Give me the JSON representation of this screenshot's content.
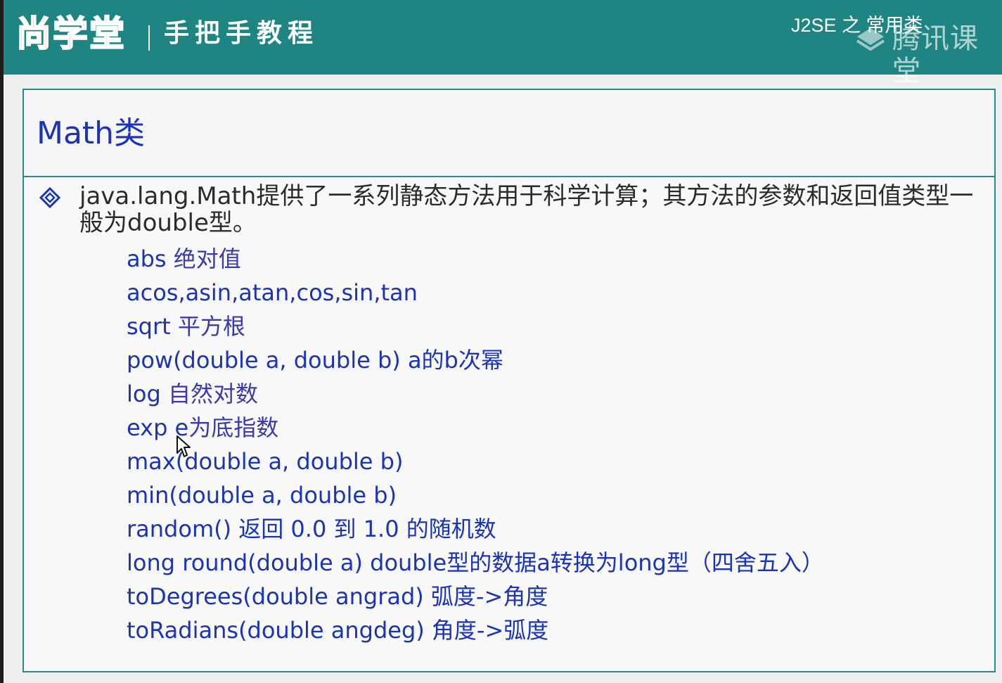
{
  "header": {
    "logo_text": "尚学堂",
    "tagline": "手把手教程",
    "course_title": "J2SE 之 常用类",
    "watermark_text": "腾讯课堂",
    "background_color": "#1f8582"
  },
  "slide": {
    "title": "Math类",
    "intro": "java.lang.Math提供了一系列静态方法用于科学计算；其方法的参数和返回值类型一般为double型。",
    "methods": [
      {
        "sig": "abs",
        "desc": " 绝对值"
      },
      {
        "sig": "acos,asin,atan,cos,sin,tan",
        "desc": ""
      },
      {
        "sig": "sqrt",
        "desc": " 平方根"
      },
      {
        "sig": "pow(double a, double b) a的b次幂",
        "desc": ""
      },
      {
        "sig": "log",
        "desc": " 自然对数"
      },
      {
        "sig": "exp e",
        "desc": "为底指数"
      },
      {
        "sig": "max(double a, double b)",
        "desc": ""
      },
      {
        "sig": "min(double a, double b)",
        "desc": ""
      },
      {
        "sig": "random() 返回 0.0 到 1.0 的随机数",
        "desc": ""
      },
      {
        "sig": "long round(double a) double型的数据a转换为long型（四舍五入）",
        "desc": ""
      },
      {
        "sig": "toDegrees(double angrad) 弧度->角度",
        "desc": ""
      },
      {
        "sig": "toRadians(double angdeg) 角度->弧度",
        "desc": ""
      }
    ],
    "accent_color": "#1a34b4",
    "border_color": "#2a8a86"
  },
  "icons": {
    "bullet": "diamond-bullet-icon",
    "cursor": "mouse-pointer-icon",
    "watermark": "tencent-classroom-logo-icon"
  }
}
